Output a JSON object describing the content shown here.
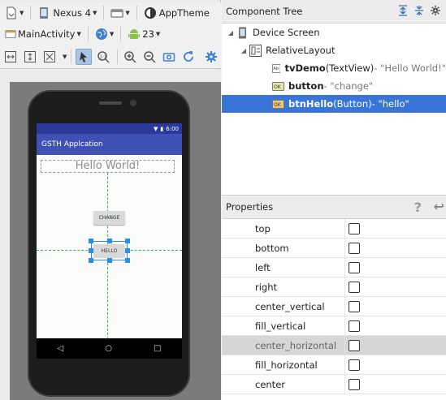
{
  "toolbar": {
    "device": "Nexus 4",
    "theme": "AppTheme",
    "activity": "MainActivity",
    "api_level": "23"
  },
  "phone": {
    "status_time": "6:00",
    "app_title": "GSTH Applcation",
    "textview_text": "Hello World!",
    "change_button_text": "CHANGE",
    "hello_button_text": "HELLO"
  },
  "component_tree": {
    "title": "Component Tree",
    "root": "Device Screen",
    "layout": "RelativeLayout",
    "items": [
      {
        "id": "tvDemo",
        "type": " (TextView)",
        "text": " - \"Hello World!\""
      },
      {
        "id": "button",
        "type": "",
        "text": " - \"change\""
      },
      {
        "id": "btnHello",
        "type": " (Button)",
        "text": " - \"hello\""
      }
    ]
  },
  "properties": {
    "title": "Properties",
    "rows": [
      {
        "name": "top",
        "checked": false
      },
      {
        "name": "bottom",
        "checked": false
      },
      {
        "name": "left",
        "checked": false
      },
      {
        "name": "right",
        "checked": false
      },
      {
        "name": "center_vertical",
        "checked": false
      },
      {
        "name": "fill_vertical",
        "checked": false
      },
      {
        "name": "center_horizontal",
        "checked": false
      },
      {
        "name": "fill_horizontal",
        "checked": false
      },
      {
        "name": "center",
        "checked": false
      }
    ]
  },
  "colors": {
    "app_bar": "#3f51b5",
    "selection": "#3875d7",
    "guide_line": "#3bb53b"
  }
}
